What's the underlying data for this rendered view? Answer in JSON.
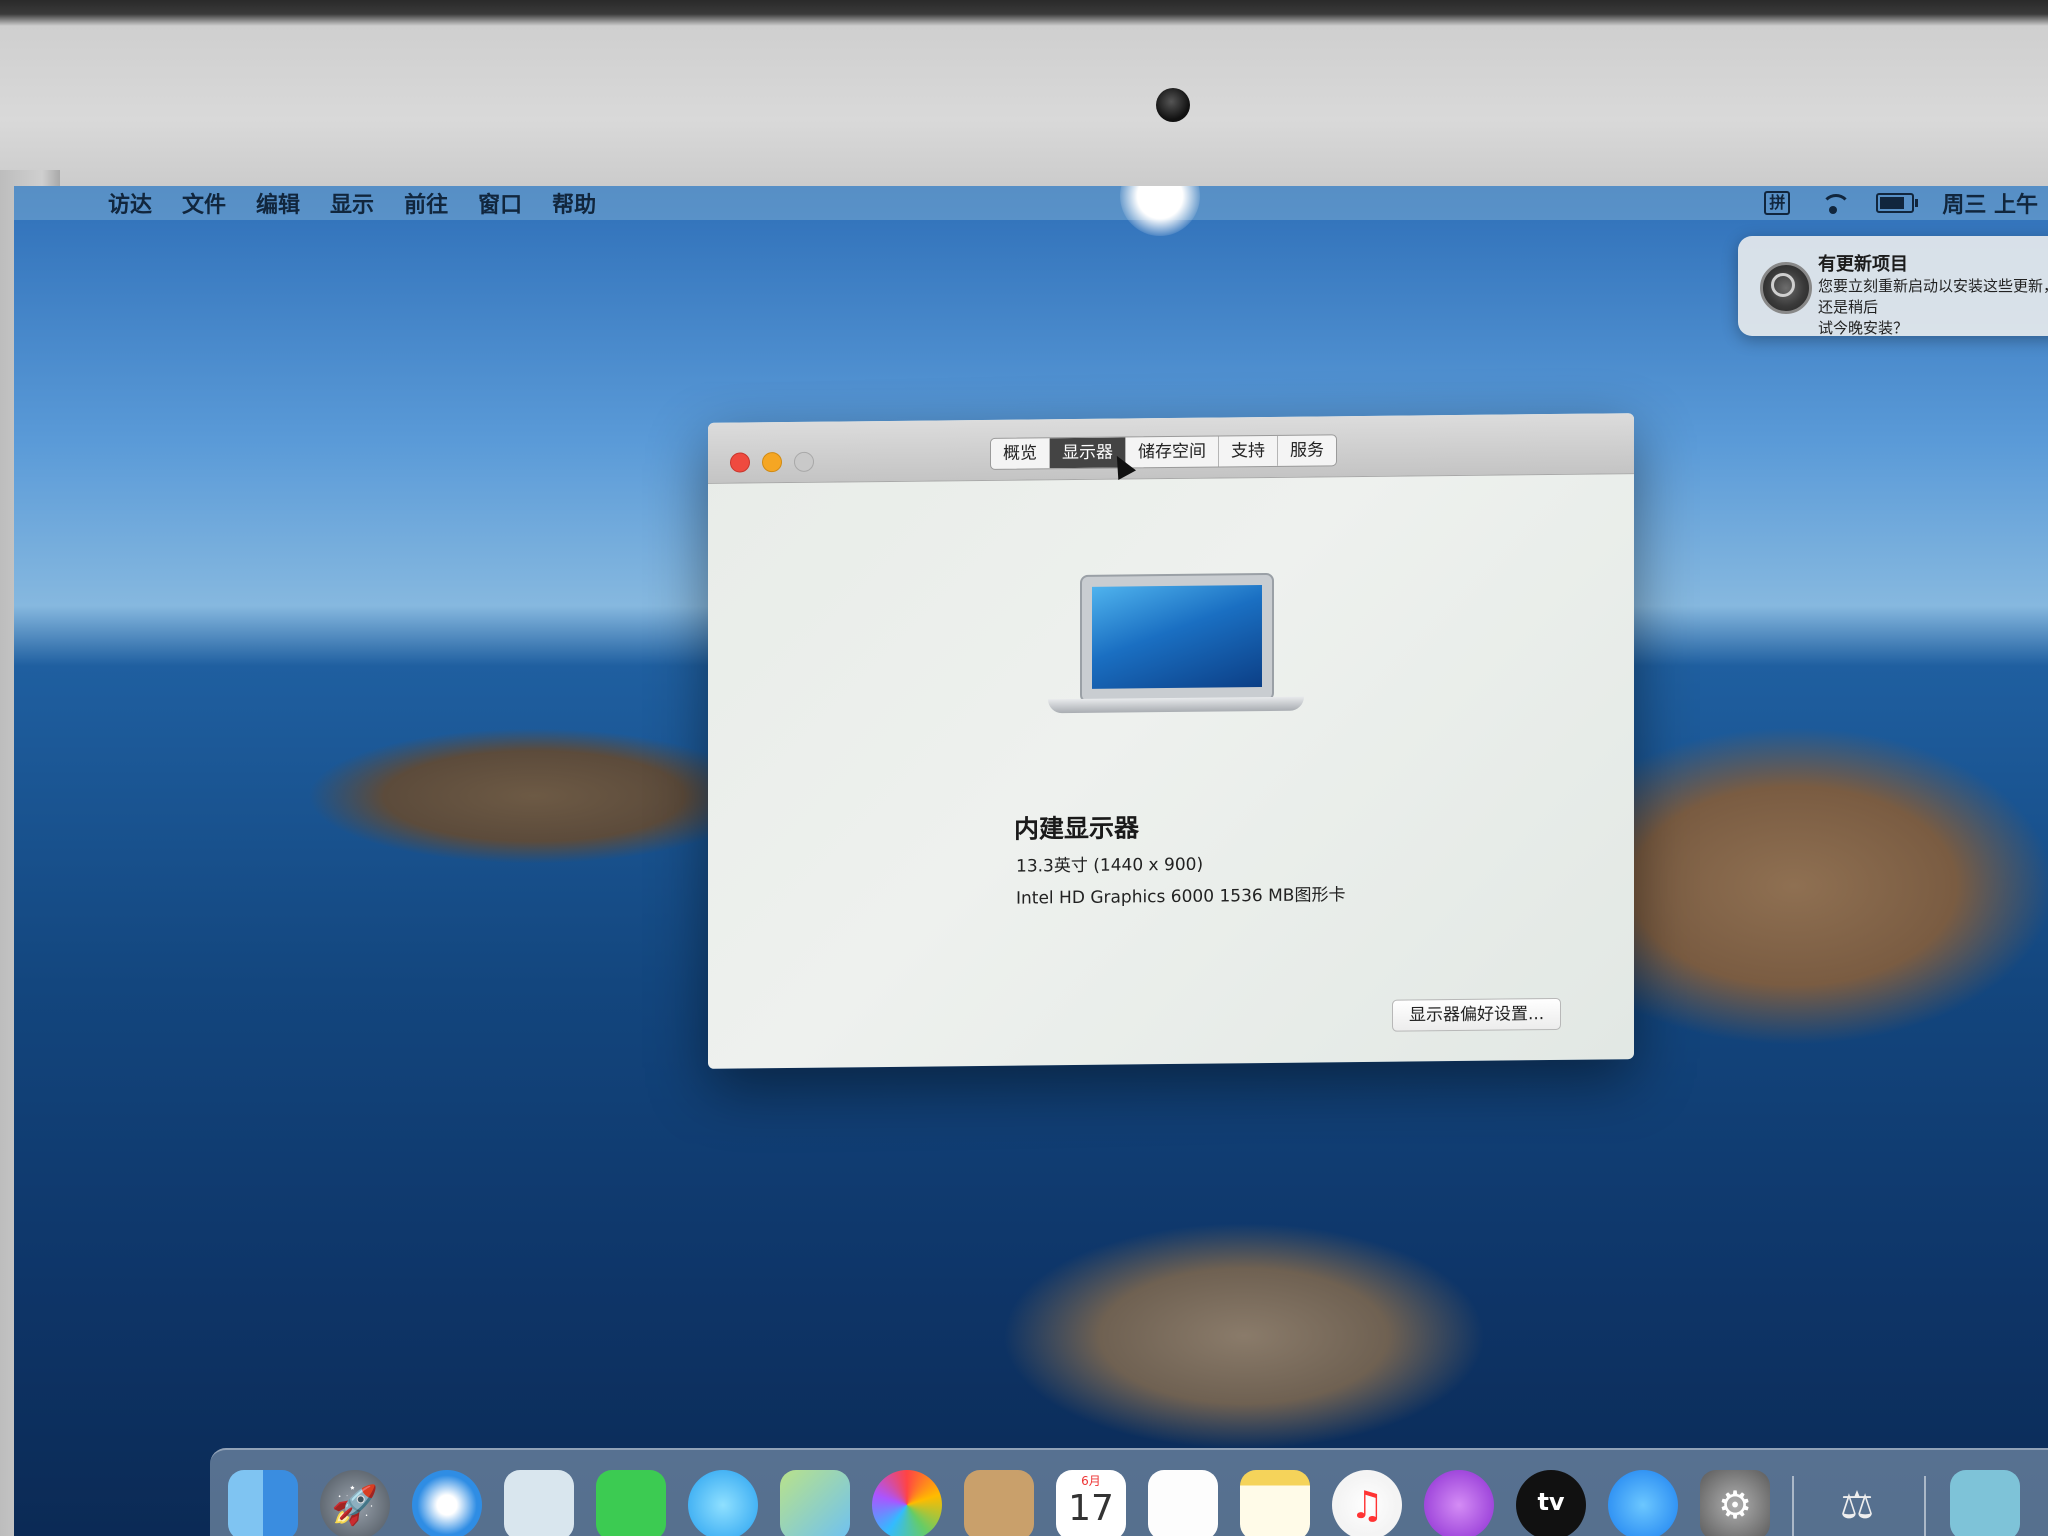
{
  "menubar": {
    "apple_icon": "apple-icon",
    "items": [
      "访达",
      "文件",
      "编辑",
      "显示",
      "前往",
      "窗口",
      "帮助"
    ],
    "input_method": "拼",
    "clock": "周三 上午"
  },
  "notification": {
    "icon": "software-update-icon",
    "title": "有更新项目",
    "body": "您要立刻重新启动以安装这些更新，还是稍后\n试今晚安装？"
  },
  "about_window": {
    "tabs": [
      {
        "label": "概览",
        "active": false
      },
      {
        "label": "显示器",
        "active": true
      },
      {
        "label": "储存空间",
        "active": false
      },
      {
        "label": "支持",
        "active": false
      },
      {
        "label": "服务",
        "active": false
      }
    ],
    "display_name": "内建显示器",
    "display_spec": "13.3英寸 (1440 x 900)",
    "graphics": "Intel HD Graphics 6000 1536 MB图形卡",
    "preferences_button": "显示器偏好设置..."
  },
  "dock": {
    "calendar_month": "6月",
    "calendar_day": "17",
    "tv_label": "tv",
    "apps": [
      "finder",
      "launchpad",
      "safari",
      "mail",
      "facetime",
      "messages",
      "maps",
      "photos",
      "contacts",
      "calendar",
      "reminders",
      "notes",
      "music",
      "podcasts",
      "tv",
      "app-store",
      "system-preferences",
      "utilities",
      "downloads"
    ]
  },
  "colors": {
    "close": "#ef4a3f",
    "minimize": "#f5a623",
    "active_tab": "#444444"
  }
}
